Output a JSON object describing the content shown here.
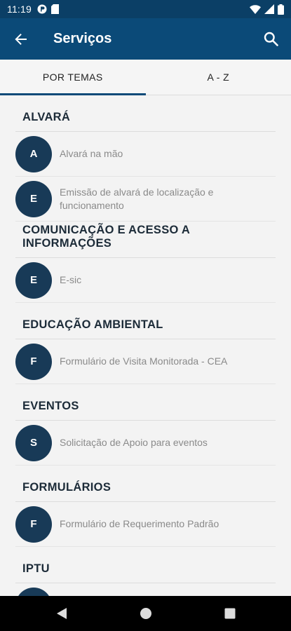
{
  "status": {
    "time": "11:19"
  },
  "app_bar": {
    "title": "Serviços"
  },
  "tabs": [
    {
      "label": "POR TEMAS",
      "active": true
    },
    {
      "label": "A - Z",
      "active": false
    }
  ],
  "sections": [
    {
      "title": "ALVARÁ",
      "items": [
        {
          "initial": "A",
          "label": "Alvará na mão"
        },
        {
          "initial": "E",
          "label": "Emissão de alvará de localização e funcionamento"
        }
      ]
    },
    {
      "title": "COMUNICAÇÃO E ACESSO A INFORMAÇÕES",
      "items": [
        {
          "initial": "E",
          "label": "E-sic"
        }
      ]
    },
    {
      "title": "EDUCAÇÃO AMBIENTAL",
      "items": [
        {
          "initial": "F",
          "label": "Formulário de Visita Monitorada - CEA"
        }
      ]
    },
    {
      "title": "EVENTOS",
      "items": [
        {
          "initial": "S",
          "label": "Solicitação de Apoio para eventos"
        }
      ]
    },
    {
      "title": "FORMULÁRIOS",
      "items": [
        {
          "initial": "F",
          "label": "Formulário de Requerimento Padrão"
        }
      ]
    },
    {
      "title": "IPTU",
      "items": [
        {
          "initial": "",
          "label": ""
        }
      ]
    }
  ],
  "icons": {
    "back": "arrow-left-icon",
    "search": "search-icon",
    "nav_back": "triangle-back-icon",
    "nav_home": "circle-home-icon",
    "nav_recents": "square-recents-icon"
  },
  "colors": {
    "status_bar": "#0b3f66",
    "app_bar": "#0b4a78",
    "avatar": "#183a57",
    "section_title": "#1c2b38",
    "item_text": "#8a8a8a"
  }
}
